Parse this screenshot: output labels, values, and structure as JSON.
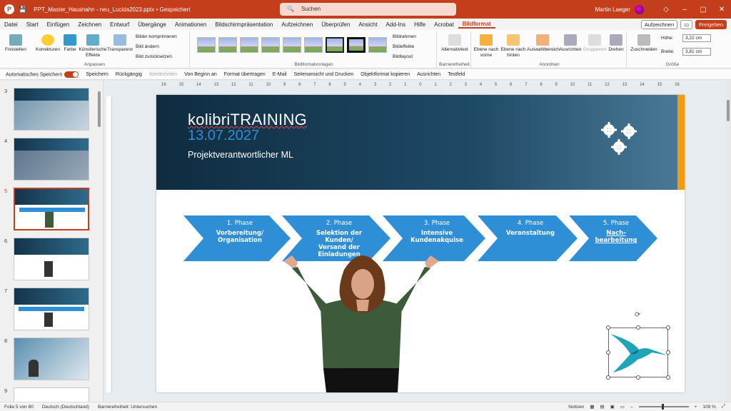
{
  "titlebar": {
    "filename": "PPT_Master_Haushahn - neu_Lucida2023.pptx • Gespeichert",
    "search_placeholder": "Suchen",
    "user": "Martin Laeger",
    "min": "–",
    "max": "▢",
    "close": "✕"
  },
  "menu": {
    "items": [
      "Datei",
      "Start",
      "Einfügen",
      "Zeichnen",
      "Entwurf",
      "Übergänge",
      "Animationen",
      "Bildschirmpräsentation",
      "Aufzeichnen",
      "Überprüfen",
      "Ansicht",
      "Add-Ins",
      "Hilfe",
      "Acrobat",
      "Bildformat"
    ],
    "active": "Bildformat",
    "record": "Aufzeichnen",
    "share": "Freigeben"
  },
  "ribbon": {
    "freistellen": "Freistellen",
    "korrekturen": "Korrekturen",
    "farbe": "Farbe",
    "kuenstlerisch": "Künstlerische Effekte",
    "transparenz": "Transparenz",
    "komprimieren": "Bilder komprimieren",
    "aendern": "Bild ändern",
    "zuruecksetzen": "Bild zurücksetzen",
    "group_anpassen": "Anpassen",
    "group_vorlagen": "Bildformatvorlagen",
    "rahmen": "Bildrahmen",
    "effekte": "Bildeffekte",
    "layout": "Bildlayout",
    "alt": "Alternativtext",
    "group_barriere": "Barrierefreiheit",
    "vorne": "Ebene nach vorne",
    "hinten": "Ebene nach hinten",
    "auswahl": "Auswahlbereich",
    "ausrichten": "Ausrichten",
    "gruppieren": "Gruppieren",
    "drehen": "Drehen",
    "group_anordnen": "Anordnen",
    "zuschneiden": "Zuschneiden",
    "hoehe_label": "Höhe:",
    "hoehe": "3,22 cm",
    "breite_label": "Breite:",
    "breite": "3,81 cm",
    "group_groesse": "Größe"
  },
  "qat": {
    "autosave": "Automatisches Speichern",
    "speichern": "Speichern",
    "rueck": "Rückgängig",
    "wieder": "Wiederholen",
    "beginn": "Von Beginn an",
    "format": "Format übertragen",
    "email": "E-Mail",
    "seitenansicht": "Seitenansicht und Drucken",
    "objektformat": "Objektformat kopieren",
    "ausrichten": "Ausrichten",
    "textfeld": "Textfeld"
  },
  "slides": {
    "numbers": [
      "3",
      "4",
      "5",
      "6",
      "7",
      "8",
      "9"
    ],
    "selected": "5"
  },
  "slide": {
    "brand": "kolibriTRAINING",
    "date": "13.07.2027",
    "subtitle": "Projektverantwortlicher ML",
    "phases": [
      {
        "num": "1. Phase",
        "name": "Vorbereitung/\nOrganisation"
      },
      {
        "num": "2. Phase",
        "name": "Selektion der\nKunden/\nVersand der\nEinladungen"
      },
      {
        "num": "3. Phase",
        "name": "Intensive\nKundenakquise"
      },
      {
        "num": "4. Phase",
        "name": "Veranstaltung"
      },
      {
        "num": "5. Phase",
        "name": "Nach-\nbearbeitung"
      }
    ]
  },
  "ruler": [
    "16",
    "15",
    "14",
    "13",
    "12",
    "11",
    "10",
    "9",
    "8",
    "7",
    "6",
    "5",
    "4",
    "3",
    "2",
    "1",
    "0",
    "1",
    "2",
    "3",
    "4",
    "5",
    "6",
    "7",
    "8",
    "9",
    "10",
    "11",
    "12",
    "13",
    "14",
    "15",
    "16"
  ],
  "status": {
    "folie": "Folie 5 von 80",
    "sprache": "Deutsch (Deutschland)",
    "barriere": "Barrierefreiheit: Untersuchen",
    "notizen": "Notizen",
    "zoom": "109 %"
  },
  "colors": {
    "accent": "#c43e1c",
    "header_dark": "#0f2c40",
    "arrow": "#2e8fd6",
    "orange": "#f39c12"
  }
}
